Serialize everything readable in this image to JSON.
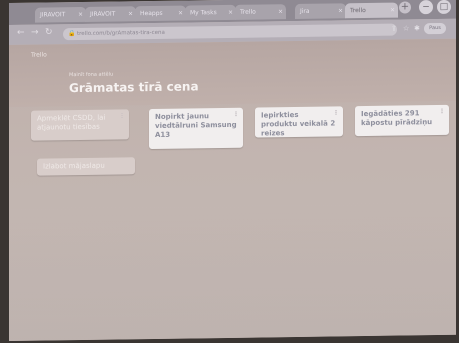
{
  "browser": {
    "tabs": [
      {
        "label": "JIRAVOIT"
      },
      {
        "label": "JIRAVOIT"
      },
      {
        "label": "Heapps"
      },
      {
        "label": "My Tasks"
      },
      {
        "label": "Trello"
      },
      {
        "label": "Jira"
      },
      {
        "label": "Trello"
      }
    ],
    "new_tab": "+",
    "url": "trello.com/b/grAmatas-tira-cena",
    "profile_label": "Paus"
  },
  "page": {
    "small_title": "Trello",
    "breadcrumb": "Mainīt fona attēlu",
    "board_title": "Grāmatas tīrā cena"
  },
  "cards": [
    {
      "text": "Apmeklēt CSDD, lai atjaunotu tiesības",
      "style": "faint"
    },
    {
      "text": "Nopirkt jaunu viedtālruni Samsung A13",
      "style": "normal"
    },
    {
      "text": "Iepirkties produktu veikalā 2 reizes",
      "style": "normal"
    },
    {
      "text": "Iegādāties 291 kāpostu pīrādziņu",
      "style": "normal"
    },
    {
      "text": "Izlabot mājaslapu",
      "style": "faint"
    }
  ]
}
